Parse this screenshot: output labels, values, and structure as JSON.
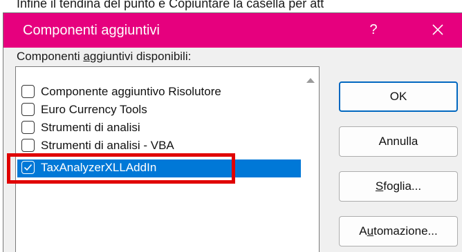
{
  "background_text": "Infine il tendina del punto e Copiuntare la casella per att",
  "dialog": {
    "title": "Componenti aggiuntivi",
    "help_label": "?",
    "list_label_pre": "Componenti ",
    "list_label_mnemonic": "a",
    "list_label_post": "ggiuntivi disponibili:",
    "items": [
      {
        "label": "Componente aggiuntivo Risolutore",
        "checked": false
      },
      {
        "label": "Euro Currency Tools",
        "checked": false
      },
      {
        "label": "Strumenti di analisi",
        "checked": false
      },
      {
        "label": "Strumenti di analisi - VBA",
        "checked": false
      },
      {
        "label": "TaxAnalyzerXLLAddIn",
        "checked": true,
        "selected": true
      }
    ],
    "buttons": {
      "ok": "OK",
      "cancel": "Annulla",
      "browse_mnemonic": "S",
      "browse_rest": "foglia...",
      "automation_pre": "A",
      "automation_mnemonic": "u",
      "automation_post": "tomazione..."
    }
  },
  "colors": {
    "titlebar": "#e6007e",
    "selection": "#0078d7",
    "highlight_box": "#e00000"
  }
}
